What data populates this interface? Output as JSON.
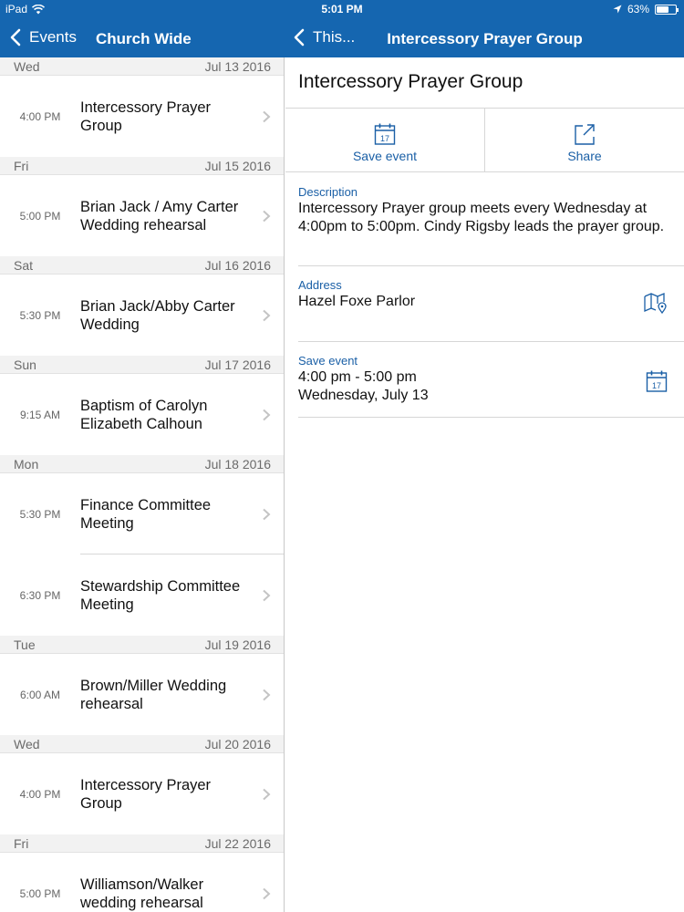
{
  "status_bar": {
    "carrier": "iPad",
    "time": "5:01 PM",
    "battery": "63%",
    "battery_level": 0.63
  },
  "left_nav": {
    "back_label": "Events",
    "title": "Church Wide"
  },
  "right_nav": {
    "back_label": "This...",
    "title": "Intercessory Prayer Group"
  },
  "events_list": {
    "days": [
      {
        "dow": "Wed",
        "date": "Jul 13 2016",
        "events": [
          {
            "time": "4:00 PM",
            "title": "Intercessory Prayer Group"
          }
        ]
      },
      {
        "dow": "Fri",
        "date": "Jul 15 2016",
        "events": [
          {
            "time": "5:00 PM",
            "title": "Brian Jack / Amy Carter Wedding rehearsal"
          }
        ]
      },
      {
        "dow": "Sat",
        "date": "Jul 16 2016",
        "events": [
          {
            "time": "5:30 PM",
            "title": "Brian Jack/Abby Carter Wedding"
          }
        ]
      },
      {
        "dow": "Sun",
        "date": "Jul 17 2016",
        "events": [
          {
            "time": "9:15 AM",
            "title": "Baptism of Carolyn Elizabeth Calhoun"
          }
        ]
      },
      {
        "dow": "Mon",
        "date": "Jul 18 2016",
        "events": [
          {
            "time": "5:30 PM",
            "title": "Finance Committee Meeting"
          },
          {
            "time": "6:30 PM",
            "title": "Stewardship Committee Meeting"
          }
        ]
      },
      {
        "dow": "Tue",
        "date": "Jul 19 2016",
        "events": [
          {
            "time": "6:00 AM",
            "title": "Brown/Miller Wedding rehearsal"
          }
        ]
      },
      {
        "dow": "Wed",
        "date": "Jul 20 2016",
        "events": [
          {
            "time": "4:00 PM",
            "title": "Intercessory Prayer Group"
          }
        ]
      },
      {
        "dow": "Fri",
        "date": "Jul 22 2016",
        "events": [
          {
            "time": "5:00 PM",
            "title": "Williamson/Walker wedding rehearsal"
          }
        ]
      }
    ]
  },
  "detail": {
    "title": "Intercessory Prayer Group",
    "calendar_icon_day": "17",
    "actions": {
      "save_label": "Save event",
      "share_label": "Share"
    },
    "description": {
      "label": "Description",
      "text": "Intercessory Prayer group meets every Wednesday at 4:00pm to 5:00pm. Cindy Rigsby leads the prayer group."
    },
    "address": {
      "label": "Address",
      "text": "Hazel Foxe Parlor"
    },
    "save_event": {
      "label": "Save event",
      "time_range": "4:00 pm - 5:00 pm",
      "date": "Wednesday, July 13"
    }
  },
  "colors": {
    "nav_blue": "#1566b0",
    "label_blue": "#1a5fa6"
  }
}
